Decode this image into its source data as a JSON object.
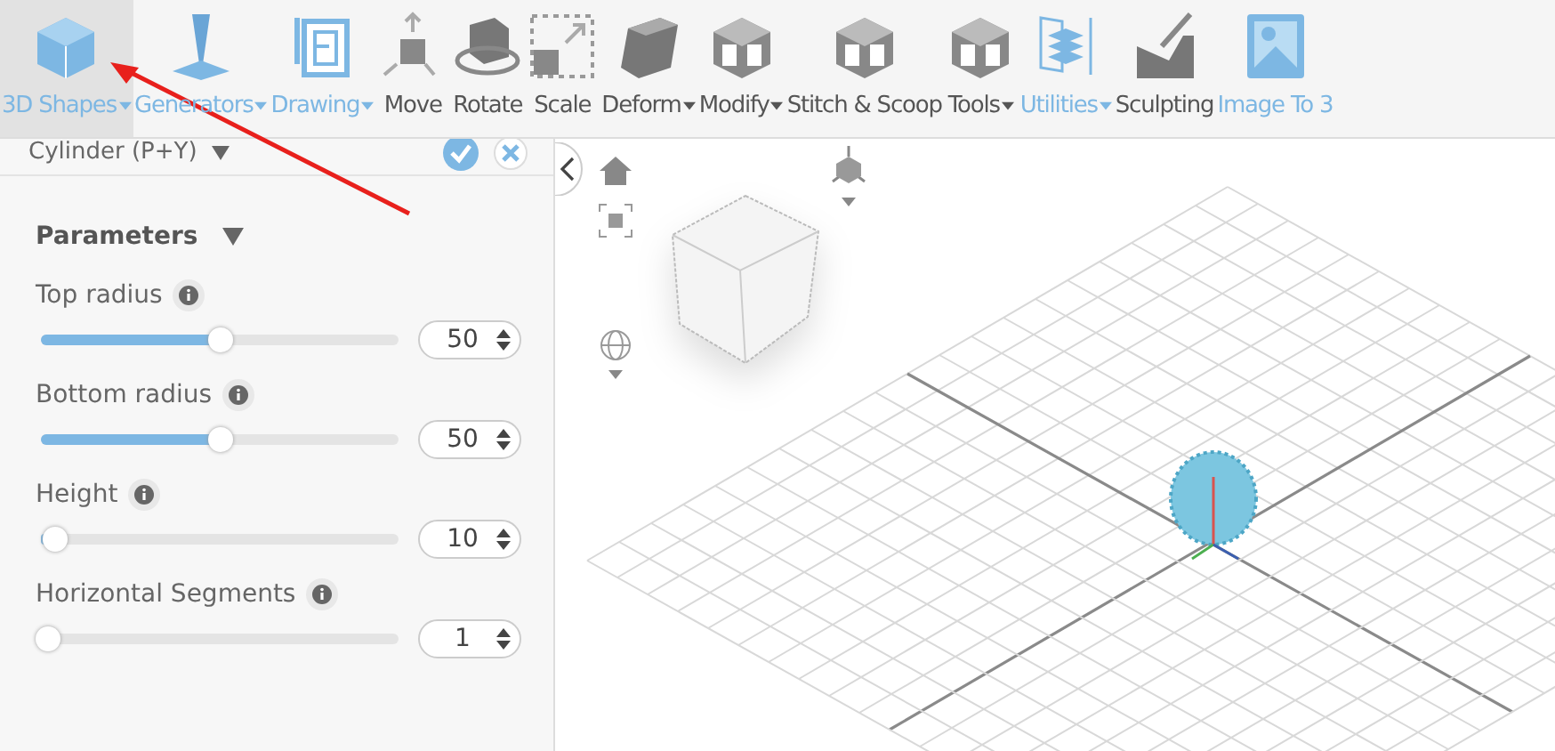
{
  "toolbar": [
    {
      "label": "3D Shapes",
      "dropdown": true,
      "selected": true,
      "color": "#7db7e3"
    },
    {
      "label": "Generators",
      "dropdown": true,
      "selected": false,
      "color": "#7db7e3"
    },
    {
      "label": "Drawing",
      "dropdown": true,
      "selected": false,
      "color": "#7db7e3"
    },
    {
      "label": "Move",
      "dropdown": false,
      "selected": false,
      "color": "#555555"
    },
    {
      "label": "Rotate",
      "dropdown": false,
      "selected": false,
      "color": "#555555"
    },
    {
      "label": "Scale",
      "dropdown": false,
      "selected": false,
      "color": "#555555"
    },
    {
      "label": "Deform",
      "dropdown": true,
      "selected": false,
      "color": "#555555"
    },
    {
      "label": "Modify",
      "dropdown": true,
      "selected": false,
      "color": "#555555"
    },
    {
      "label": "Stitch & Scoop",
      "dropdown": false,
      "selected": false,
      "color": "#555555"
    },
    {
      "label": "Tools",
      "dropdown": true,
      "selected": false,
      "color": "#555555"
    },
    {
      "label": "Utilities",
      "dropdown": true,
      "selected": false,
      "color": "#7db7e3"
    },
    {
      "label": "Sculpting",
      "dropdown": false,
      "selected": false,
      "color": "#555555"
    },
    {
      "label": "Image To 3",
      "dropdown": false,
      "selected": false,
      "color": "#7db7e3"
    }
  ],
  "panel": {
    "object_name": "Cylinder (P+Y)",
    "section": "Parameters",
    "parameters": [
      {
        "name": "Top radius",
        "value": "50",
        "level": 0.5
      },
      {
        "name": "Bottom radius",
        "value": "50",
        "level": 0.5
      },
      {
        "name": "Height",
        "value": "10",
        "level": 0.02
      },
      {
        "name": "Horizontal Segments",
        "value": "1",
        "level": 0
      }
    ]
  }
}
